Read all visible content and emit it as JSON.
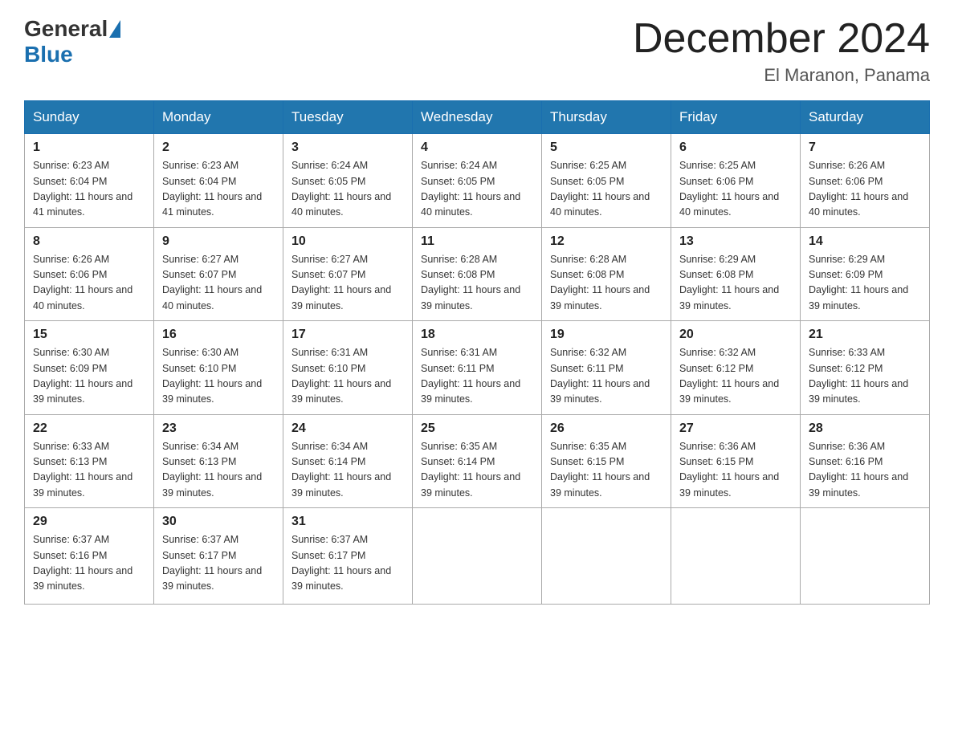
{
  "header": {
    "logo_general": "General",
    "logo_blue": "Blue",
    "month_title": "December 2024",
    "location": "El Maranon, Panama"
  },
  "days_of_week": [
    "Sunday",
    "Monday",
    "Tuesday",
    "Wednesday",
    "Thursday",
    "Friday",
    "Saturday"
  ],
  "weeks": [
    [
      {
        "day": "1",
        "sunrise": "6:23 AM",
        "sunset": "6:04 PM",
        "daylight": "11 hours and 41 minutes."
      },
      {
        "day": "2",
        "sunrise": "6:23 AM",
        "sunset": "6:04 PM",
        "daylight": "11 hours and 41 minutes."
      },
      {
        "day": "3",
        "sunrise": "6:24 AM",
        "sunset": "6:05 PM",
        "daylight": "11 hours and 40 minutes."
      },
      {
        "day": "4",
        "sunrise": "6:24 AM",
        "sunset": "6:05 PM",
        "daylight": "11 hours and 40 minutes."
      },
      {
        "day": "5",
        "sunrise": "6:25 AM",
        "sunset": "6:05 PM",
        "daylight": "11 hours and 40 minutes."
      },
      {
        "day": "6",
        "sunrise": "6:25 AM",
        "sunset": "6:06 PM",
        "daylight": "11 hours and 40 minutes."
      },
      {
        "day": "7",
        "sunrise": "6:26 AM",
        "sunset": "6:06 PM",
        "daylight": "11 hours and 40 minutes."
      }
    ],
    [
      {
        "day": "8",
        "sunrise": "6:26 AM",
        "sunset": "6:06 PM",
        "daylight": "11 hours and 40 minutes."
      },
      {
        "day": "9",
        "sunrise": "6:27 AM",
        "sunset": "6:07 PM",
        "daylight": "11 hours and 40 minutes."
      },
      {
        "day": "10",
        "sunrise": "6:27 AM",
        "sunset": "6:07 PM",
        "daylight": "11 hours and 39 minutes."
      },
      {
        "day": "11",
        "sunrise": "6:28 AM",
        "sunset": "6:08 PM",
        "daylight": "11 hours and 39 minutes."
      },
      {
        "day": "12",
        "sunrise": "6:28 AM",
        "sunset": "6:08 PM",
        "daylight": "11 hours and 39 minutes."
      },
      {
        "day": "13",
        "sunrise": "6:29 AM",
        "sunset": "6:08 PM",
        "daylight": "11 hours and 39 minutes."
      },
      {
        "day": "14",
        "sunrise": "6:29 AM",
        "sunset": "6:09 PM",
        "daylight": "11 hours and 39 minutes."
      }
    ],
    [
      {
        "day": "15",
        "sunrise": "6:30 AM",
        "sunset": "6:09 PM",
        "daylight": "11 hours and 39 minutes."
      },
      {
        "day": "16",
        "sunrise": "6:30 AM",
        "sunset": "6:10 PM",
        "daylight": "11 hours and 39 minutes."
      },
      {
        "day": "17",
        "sunrise": "6:31 AM",
        "sunset": "6:10 PM",
        "daylight": "11 hours and 39 minutes."
      },
      {
        "day": "18",
        "sunrise": "6:31 AM",
        "sunset": "6:11 PM",
        "daylight": "11 hours and 39 minutes."
      },
      {
        "day": "19",
        "sunrise": "6:32 AM",
        "sunset": "6:11 PM",
        "daylight": "11 hours and 39 minutes."
      },
      {
        "day": "20",
        "sunrise": "6:32 AM",
        "sunset": "6:12 PM",
        "daylight": "11 hours and 39 minutes."
      },
      {
        "day": "21",
        "sunrise": "6:33 AM",
        "sunset": "6:12 PM",
        "daylight": "11 hours and 39 minutes."
      }
    ],
    [
      {
        "day": "22",
        "sunrise": "6:33 AM",
        "sunset": "6:13 PM",
        "daylight": "11 hours and 39 minutes."
      },
      {
        "day": "23",
        "sunrise": "6:34 AM",
        "sunset": "6:13 PM",
        "daylight": "11 hours and 39 minutes."
      },
      {
        "day": "24",
        "sunrise": "6:34 AM",
        "sunset": "6:14 PM",
        "daylight": "11 hours and 39 minutes."
      },
      {
        "day": "25",
        "sunrise": "6:35 AM",
        "sunset": "6:14 PM",
        "daylight": "11 hours and 39 minutes."
      },
      {
        "day": "26",
        "sunrise": "6:35 AM",
        "sunset": "6:15 PM",
        "daylight": "11 hours and 39 minutes."
      },
      {
        "day": "27",
        "sunrise": "6:36 AM",
        "sunset": "6:15 PM",
        "daylight": "11 hours and 39 minutes."
      },
      {
        "day": "28",
        "sunrise": "6:36 AM",
        "sunset": "6:16 PM",
        "daylight": "11 hours and 39 minutes."
      }
    ],
    [
      {
        "day": "29",
        "sunrise": "6:37 AM",
        "sunset": "6:16 PM",
        "daylight": "11 hours and 39 minutes."
      },
      {
        "day": "30",
        "sunrise": "6:37 AM",
        "sunset": "6:17 PM",
        "daylight": "11 hours and 39 minutes."
      },
      {
        "day": "31",
        "sunrise": "6:37 AM",
        "sunset": "6:17 PM",
        "daylight": "11 hours and 39 minutes."
      },
      null,
      null,
      null,
      null
    ]
  ]
}
